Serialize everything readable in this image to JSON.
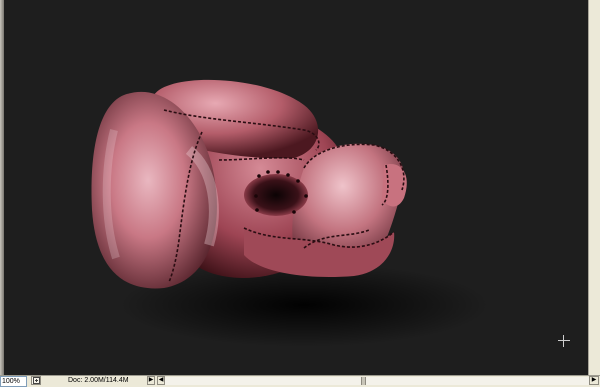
{
  "status_bar": {
    "zoom": "100%",
    "doc_size": "Doc: 2.00M/114.4M",
    "menu_arrow": "▶",
    "scroll_left": "◀",
    "scroll_right": "▶"
  },
  "canvas": {
    "background": "#1e1e1e",
    "subject": "boxing-glove-illustration",
    "glove_base_color": "#b8505e",
    "stitch_color": "#2a0d12"
  }
}
